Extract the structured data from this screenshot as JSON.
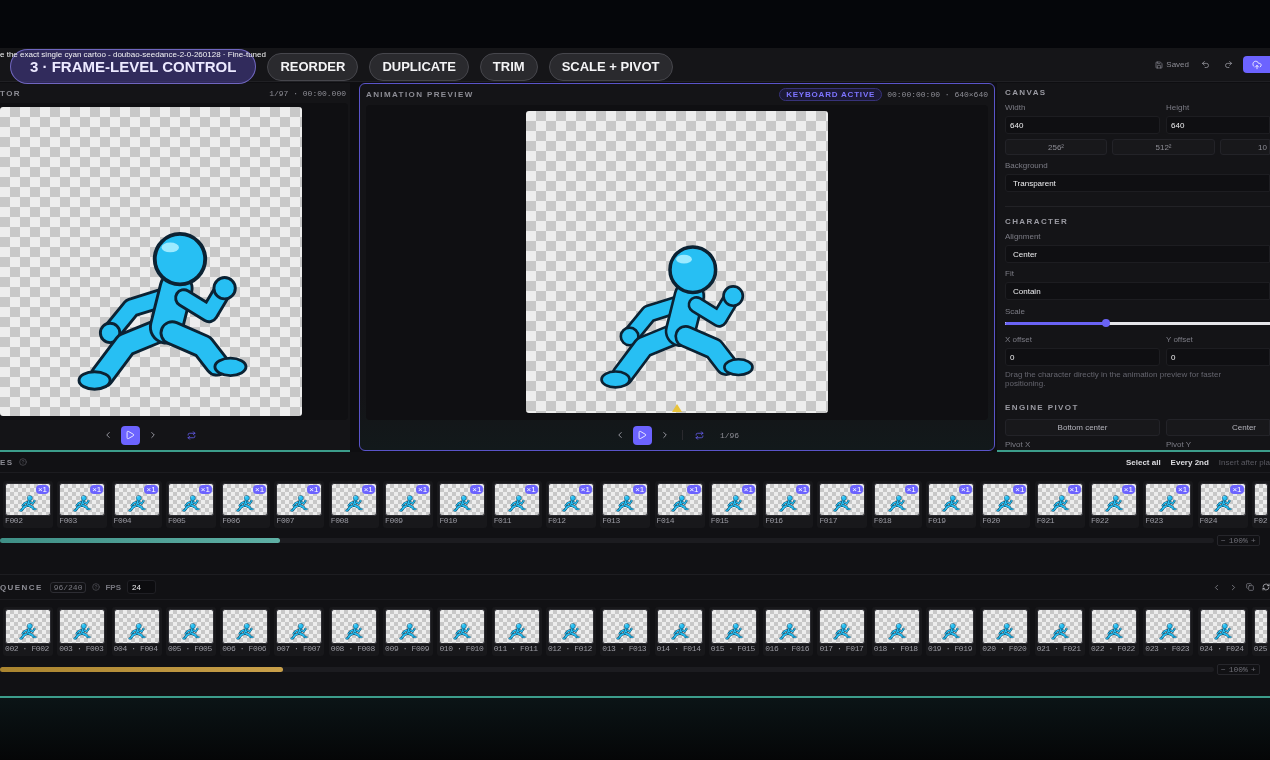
{
  "header": {
    "title": "e the exact single cyan cartoo - doubao-seedance-2-0-260128 · Fine-tuned",
    "save_status": "Saved"
  },
  "caption_pills": [
    {
      "label": "3 · FRAME-LEVEL CONTROL",
      "kind": "step"
    },
    {
      "label": "REORDER",
      "kind": "feature"
    },
    {
      "label": "DUPLICATE",
      "kind": "feature"
    },
    {
      "label": "TRIM",
      "kind": "feature"
    },
    {
      "label": "SCALE + PIVOT",
      "kind": "feature"
    }
  ],
  "editor_panel": {
    "title": "TOR",
    "frame_info": "1/97 · 00:00.000"
  },
  "preview_panel": {
    "title": "ANIMATION PREVIEW",
    "badge": "KEYBOARD ACTIVE",
    "timecode": "00:00:00:00 · 640×640",
    "frame_counter": "1/96"
  },
  "inspector": {
    "canvas": {
      "title": "CANVAS",
      "width": {
        "label": "Width",
        "value": "640"
      },
      "height": {
        "label": "Height",
        "value": "640"
      },
      "presets": [
        "256²",
        "512²",
        "10"
      ],
      "background": {
        "label": "Background",
        "value": "Transparent"
      }
    },
    "character": {
      "title": "CHARACTER",
      "alignment": {
        "label": "Alignment",
        "value": "Center"
      },
      "fit": {
        "label": "Fit",
        "value": "Contain"
      },
      "scale": {
        "label": "Scale",
        "level": 0.38
      },
      "x_offset": {
        "label": "X offset",
        "value": "0"
      },
      "y_offset": {
        "label": "Y offset",
        "value": "0"
      },
      "hint": "Drag the character directly in the animation preview for faster positioning."
    },
    "engine_pivot": {
      "title": "ENGINE PIVOT",
      "presets": [
        "Bottom center",
        "Center"
      ],
      "pivot_x": {
        "label": "Pivot X"
      },
      "pivot_y": {
        "label": "Pivot Y"
      }
    }
  },
  "frames": {
    "title": "ES",
    "actions": [
      {
        "label": "Select all",
        "disabled": false
      },
      {
        "label": "Every 2nd",
        "disabled": false
      },
      {
        "label": "Insert after pla",
        "disabled": true
      }
    ],
    "items": [
      {
        "label": "F002",
        "badge": "×1"
      },
      {
        "label": "F003",
        "badge": "×1"
      },
      {
        "label": "F004",
        "badge": "×1"
      },
      {
        "label": "F005",
        "badge": "×1"
      },
      {
        "label": "F006",
        "badge": "×1"
      },
      {
        "label": "F007",
        "badge": "×1"
      },
      {
        "label": "F008",
        "badge": "×1"
      },
      {
        "label": "F009",
        "badge": "×1"
      },
      {
        "label": "F010",
        "badge": "×1"
      },
      {
        "label": "F011",
        "badge": "×1"
      },
      {
        "label": "F012",
        "badge": "×1"
      },
      {
        "label": "F013",
        "badge": "×1"
      },
      {
        "label": "F014",
        "badge": "×1"
      },
      {
        "label": "F015",
        "badge": "×1"
      },
      {
        "label": "F016",
        "badge": "×1"
      },
      {
        "label": "F017",
        "badge": "×1"
      },
      {
        "label": "F018",
        "badge": "×1"
      },
      {
        "label": "F019",
        "badge": "×1"
      },
      {
        "label": "F020",
        "badge": "×1"
      },
      {
        "label": "F021",
        "badge": "×1"
      },
      {
        "label": "F022",
        "badge": "×1"
      },
      {
        "label": "F023",
        "badge": "×1"
      },
      {
        "label": "F024",
        "badge": "×1"
      },
      {
        "label": "F02"
      }
    ],
    "zoom": {
      "out": "−",
      "value": "100%",
      "in": "+"
    }
  },
  "sequence": {
    "title": "QUENCE",
    "count": "96/240",
    "fps_label": "FPS",
    "fps": "24",
    "items": [
      {
        "label": "002 · F002"
      },
      {
        "label": "003 · F003"
      },
      {
        "label": "004 · F004"
      },
      {
        "label": "005 · F005"
      },
      {
        "label": "006 · F006"
      },
      {
        "label": "007 · F007"
      },
      {
        "label": "008 · F008"
      },
      {
        "label": "009 · F009"
      },
      {
        "label": "010 · F010"
      },
      {
        "label": "011 · F011"
      },
      {
        "label": "012 · F012"
      },
      {
        "label": "013 · F013"
      },
      {
        "label": "014 · F014"
      },
      {
        "label": "015 · F015"
      },
      {
        "label": "016 · F016"
      },
      {
        "label": "017 · F017"
      },
      {
        "label": "018 · F018"
      },
      {
        "label": "019 · F019"
      },
      {
        "label": "020 · F020"
      },
      {
        "label": "021 · F021"
      },
      {
        "label": "022 · F022"
      },
      {
        "label": "023 · F023"
      },
      {
        "label": "024 · F024"
      },
      {
        "label": "025"
      }
    ],
    "zoom": {
      "out": "−",
      "value": "100%",
      "in": "+"
    }
  }
}
